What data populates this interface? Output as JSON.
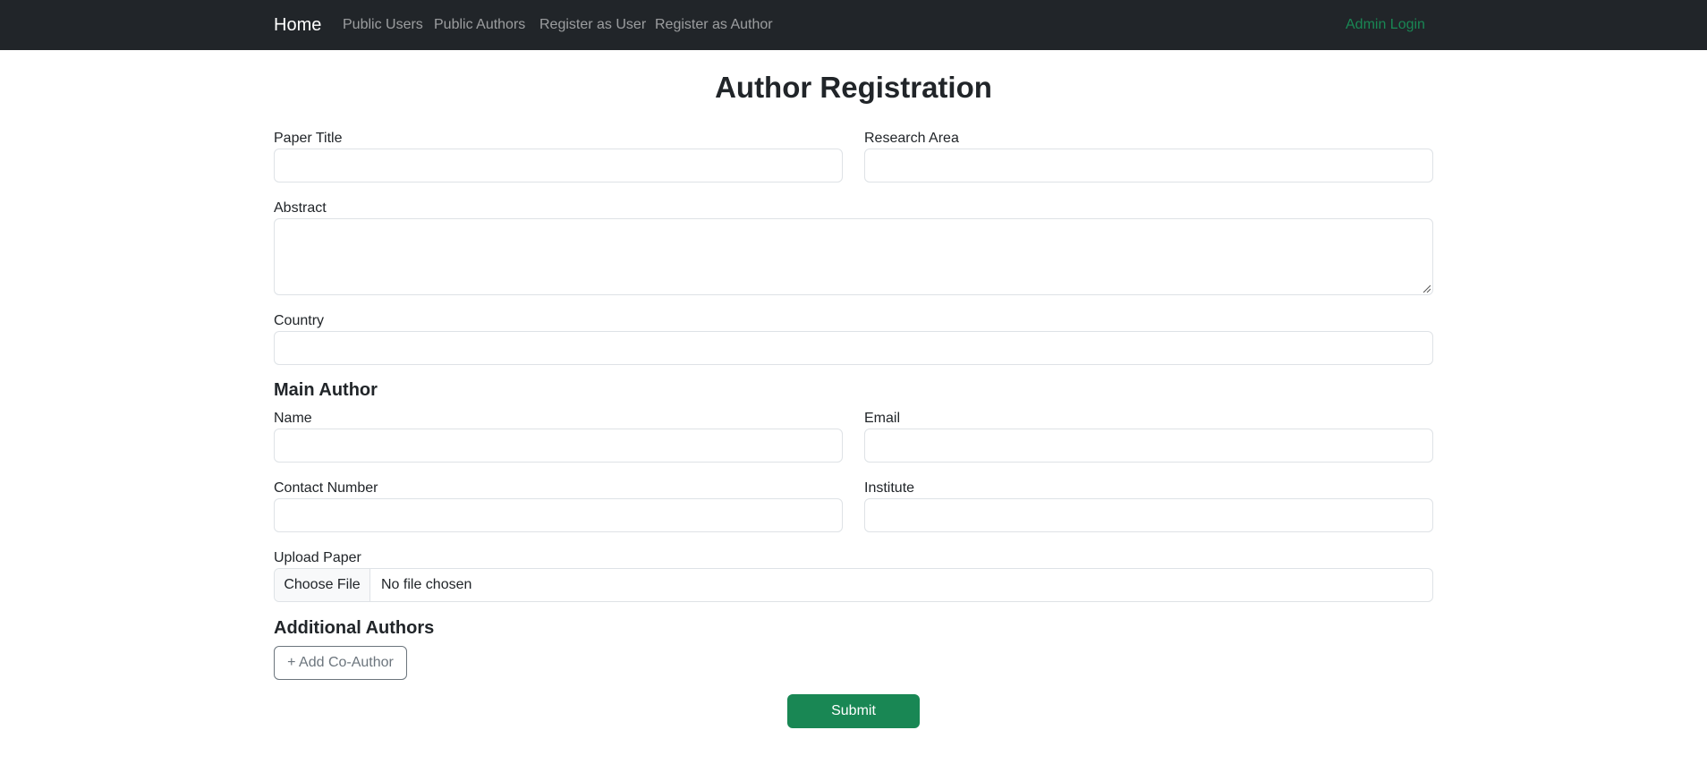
{
  "nav": {
    "brand": "Home",
    "links": [
      "Public Users",
      "Public Authors",
      "Register as User",
      "Register as Author"
    ],
    "admin_link": "Admin Login"
  },
  "page": {
    "title": "Author Registration"
  },
  "form": {
    "paper_title_label": "Paper Title",
    "research_area_label": "Research Area",
    "abstract_label": "Abstract",
    "country_label": "Country",
    "main_author_heading": "Main Author",
    "name_label": "Name",
    "email_label": "Email",
    "contact_label": "Contact Number",
    "institute_label": "Institute",
    "upload_label": "Upload Paper",
    "choose_file_label": "Choose File",
    "file_status": "No file chosen",
    "additional_authors_heading": "Additional Authors",
    "add_coauthor_label": "+ Add Co-Author",
    "submit_label": "Submit"
  },
  "colors": {
    "navbar_bg": "#212529",
    "nav_link": "rgba(255,255,255,0.55)",
    "admin_link": "#198754",
    "submit_bg": "#198754",
    "input_border": "#dee2e6",
    "outline_button": "#6c757d"
  }
}
